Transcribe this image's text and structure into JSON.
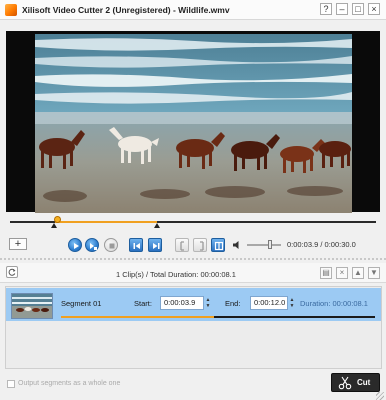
{
  "window": {
    "title": "Xilisoft Video Cutter 2 (Unregistered) - Wildlife.wmv",
    "buttons": [
      "help",
      "minimize",
      "maximize",
      "close"
    ]
  },
  "player": {
    "time_current": "0:00:03.9",
    "time_total": "0:00:30.0",
    "time_display": "0:00:03.9 / 0:00:30.0"
  },
  "controls": {
    "add_label": "+",
    "icons": [
      "play-icon",
      "play-segment-icon",
      "stop-icon",
      "previous-frame-icon",
      "next-frame-icon",
      "set-start-icon",
      "set-end-icon",
      "split-icon",
      "volume-icon"
    ]
  },
  "clips": {
    "summary": "1 Clip(s) /  Total Duration: 00:00:08.1"
  },
  "segment": {
    "name": "Segment 01",
    "start_label": "Start:",
    "start_value": "0:00:03.9",
    "end_label": "End:",
    "end_value": "0:00:12.0",
    "duration": "Duration: 00:00:08.1"
  },
  "footer": {
    "checkbox_label": "Output segments as a whole one",
    "cut_label": "Cut"
  },
  "colors": {
    "accent": "#f0a020",
    "selection": "#9ccaf3",
    "button_blue": "#2f7fd0"
  }
}
